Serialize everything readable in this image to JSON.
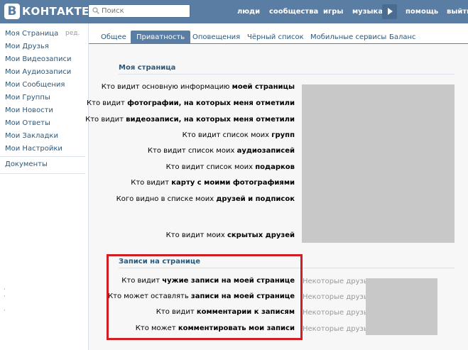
{
  "header": {
    "logo_letter": "В",
    "logo_text": "КОНТАКТЕ",
    "search_placeholder": "Поиск",
    "nav": [
      "люди",
      "сообщества",
      "игры",
      "музыка",
      "помощь",
      "выйти"
    ]
  },
  "sidebar": {
    "edit_label": "ред.",
    "items": [
      "Моя Страница",
      "Мои Друзья",
      "Мои Видеозаписи",
      "Мои Аудиозаписи",
      "Мои Сообщения",
      "Мои Группы",
      "Мои Новости",
      "Мои Ответы",
      "Мои Закладки",
      "Мои Настройки"
    ],
    "extra": "Документы"
  },
  "tabs": [
    "Общее",
    "Приватность",
    "Оповещения",
    "Чёрный список",
    "Мобильные сервисы",
    "Баланс"
  ],
  "active_tab": 1,
  "section1": {
    "title": "Моя страница",
    "rows": [
      {
        "plain": "Кто видит основную информацию ",
        "bold": "моей страницы"
      },
      {
        "plain": "Кто видит ",
        "bold": "фотографии, на которых меня отметили"
      },
      {
        "plain": "Кто видит ",
        "bold": "видеозаписи, на которых меня отметили"
      },
      {
        "plain": "Кто видит список моих ",
        "bold": "групп"
      },
      {
        "plain": "Кто видит список моих ",
        "bold": "аудиозаписей"
      },
      {
        "plain": "Кто видит список моих ",
        "bold": "подарков"
      },
      {
        "plain": "Кто видит ",
        "bold": "карту с моими фотографиями"
      },
      {
        "plain": "Кого видно в списке моих ",
        "bold": "друзей и подписок"
      },
      {
        "plain": "Кто видит моих ",
        "bold": "скрытых друзей"
      }
    ]
  },
  "section2": {
    "title": "Записи на странице",
    "rows": [
      {
        "plain": "Кто видит ",
        "bold": "чужие записи на моей странице",
        "value": "Некоторые друзья: "
      },
      {
        "plain": "Кто может оставлять ",
        "bold": "записи на моей странице",
        "value": "Некоторые друзья: "
      },
      {
        "plain": "Кто видит ",
        "bold": "комментарии к записям",
        "value": "Некоторые друзья: "
      },
      {
        "plain": "Кто может ",
        "bold": "комментировать мои записи",
        "value": "Некоторые друзья: "
      }
    ]
  },
  "colors": {
    "header": "#597da3",
    "link": "#2b587a",
    "highlight_frame": "#d01e25",
    "redacted": "#c8c8c8"
  }
}
